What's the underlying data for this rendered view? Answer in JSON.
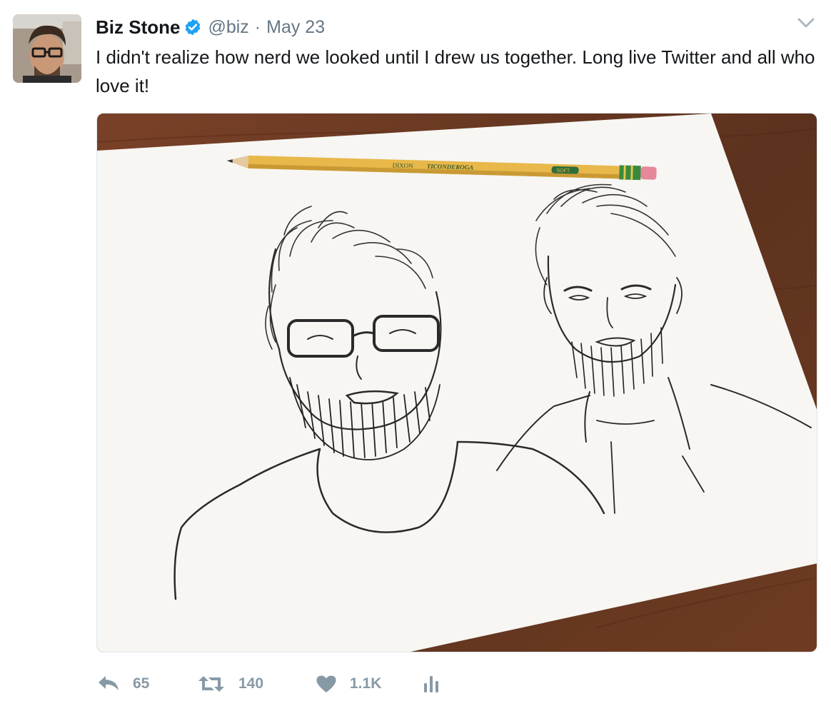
{
  "tweet": {
    "author_name": "Biz Stone",
    "handle": "@biz",
    "separator": "·",
    "date": "May 23",
    "text": "I didn't realize how nerd we looked until I drew us together. Long live Twitter and all who love it!"
  },
  "media": {
    "pencil_brand": "DIXON",
    "pencil_model": "TICONDEROGA",
    "pencil_grade": "SOFT"
  },
  "actions": {
    "reply_count": "65",
    "retweet_count": "140",
    "like_count": "1.1K"
  },
  "icons": {
    "verified": "verified-badge-icon",
    "caret": "chevron-down-icon",
    "reply": "reply-icon",
    "retweet": "retweet-icon",
    "like": "heart-icon",
    "analytics": "analytics-icon"
  },
  "colors": {
    "verified_blue": "#1da1f2",
    "action_gray": "#8899a6",
    "meta_gray": "#657786",
    "wood": "#6b3a22",
    "paper": "#f7f6f3",
    "pencil_yellow": "#e8b84a"
  }
}
